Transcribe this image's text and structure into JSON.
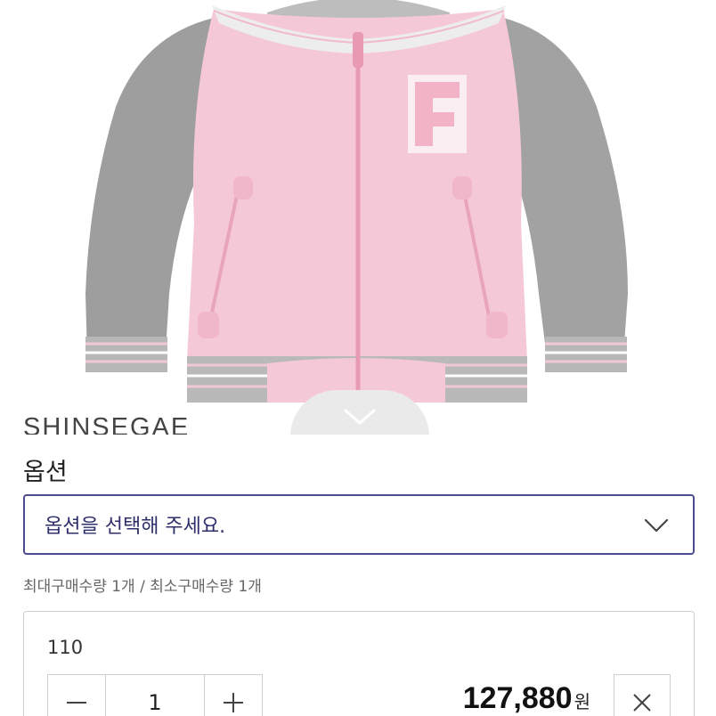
{
  "product": {
    "brand_text": "SHINSEGAE",
    "colors": {
      "body_pink": "#f4c9d8",
      "sleeve_gray": "#9d9d9d",
      "accent_navy": "#4b4b8f"
    }
  },
  "option_section": {
    "title": "옵션",
    "select_placeholder": "옵션을 선택해 주세요.",
    "purchase_limit": "최대구매수량 1개 / 최소구매수량 1개"
  },
  "selected_item": {
    "option_name": "110",
    "quantity": "1",
    "price": "127,880",
    "price_unit": "원"
  },
  "icons": {
    "collapse": "chevron-down-icon",
    "select_arrow": "chevron-down-icon",
    "decrease": "minus-icon",
    "increase": "plus-icon",
    "remove": "close-icon"
  }
}
